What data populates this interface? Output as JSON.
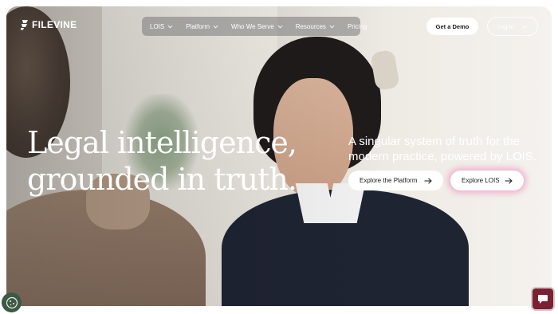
{
  "brand": {
    "name": "FILEVINE"
  },
  "nav": {
    "items": [
      {
        "label": "LOIS",
        "has_dropdown": true
      },
      {
        "label": "Platform",
        "has_dropdown": true
      },
      {
        "label": "Who We Serve",
        "has_dropdown": true
      },
      {
        "label": "Resources",
        "has_dropdown": true
      },
      {
        "label": "Pricing",
        "has_dropdown": false
      }
    ]
  },
  "header": {
    "get_demo_label": "Get a Demo",
    "login_label": "Log In"
  },
  "hero": {
    "headline_line1": "Legal intelligence,",
    "headline_line2": "grounded in truth.",
    "subtitle_line1": "A singular system of truth for the",
    "subtitle_line2": "modern practice, powered by LOIS.",
    "cta_platform_label": "Explore the Platform",
    "cta_lois_label": "Explore LOIS"
  },
  "widgets": {
    "cookie_icon": "cookie-icon",
    "chat_icon": "chat-bubble-icon"
  },
  "colors": {
    "chat_button": "#7a2232",
    "cookie_button": "#3b5a46",
    "lois_glow": "#f0a0c8"
  }
}
